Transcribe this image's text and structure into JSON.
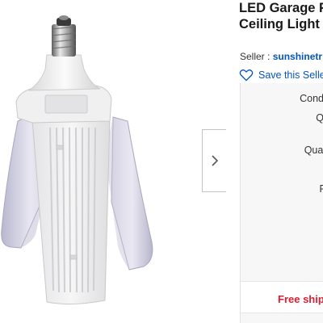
{
  "listing": {
    "title_line1": "LED Garage F",
    "title_line2": "Ceiling Light"
  },
  "seller": {
    "label": "Seller :",
    "name": "sunshinetr"
  },
  "save_seller": {
    "label": "Save this Selle",
    "icon": "heart-outline-icon"
  },
  "details": {
    "condition_label": "Conditio",
    "qty_label": "QTY",
    "quantity_label": "Quantit",
    "price_label": "Pric"
  },
  "shipping": {
    "label": "Free ship"
  },
  "gallery": {
    "next_icon": "chevron-right-icon"
  },
  "colors": {
    "link": "#0654ba",
    "shipping_accent": "#dd1e31",
    "panel_bg": "#f7f7f7"
  }
}
